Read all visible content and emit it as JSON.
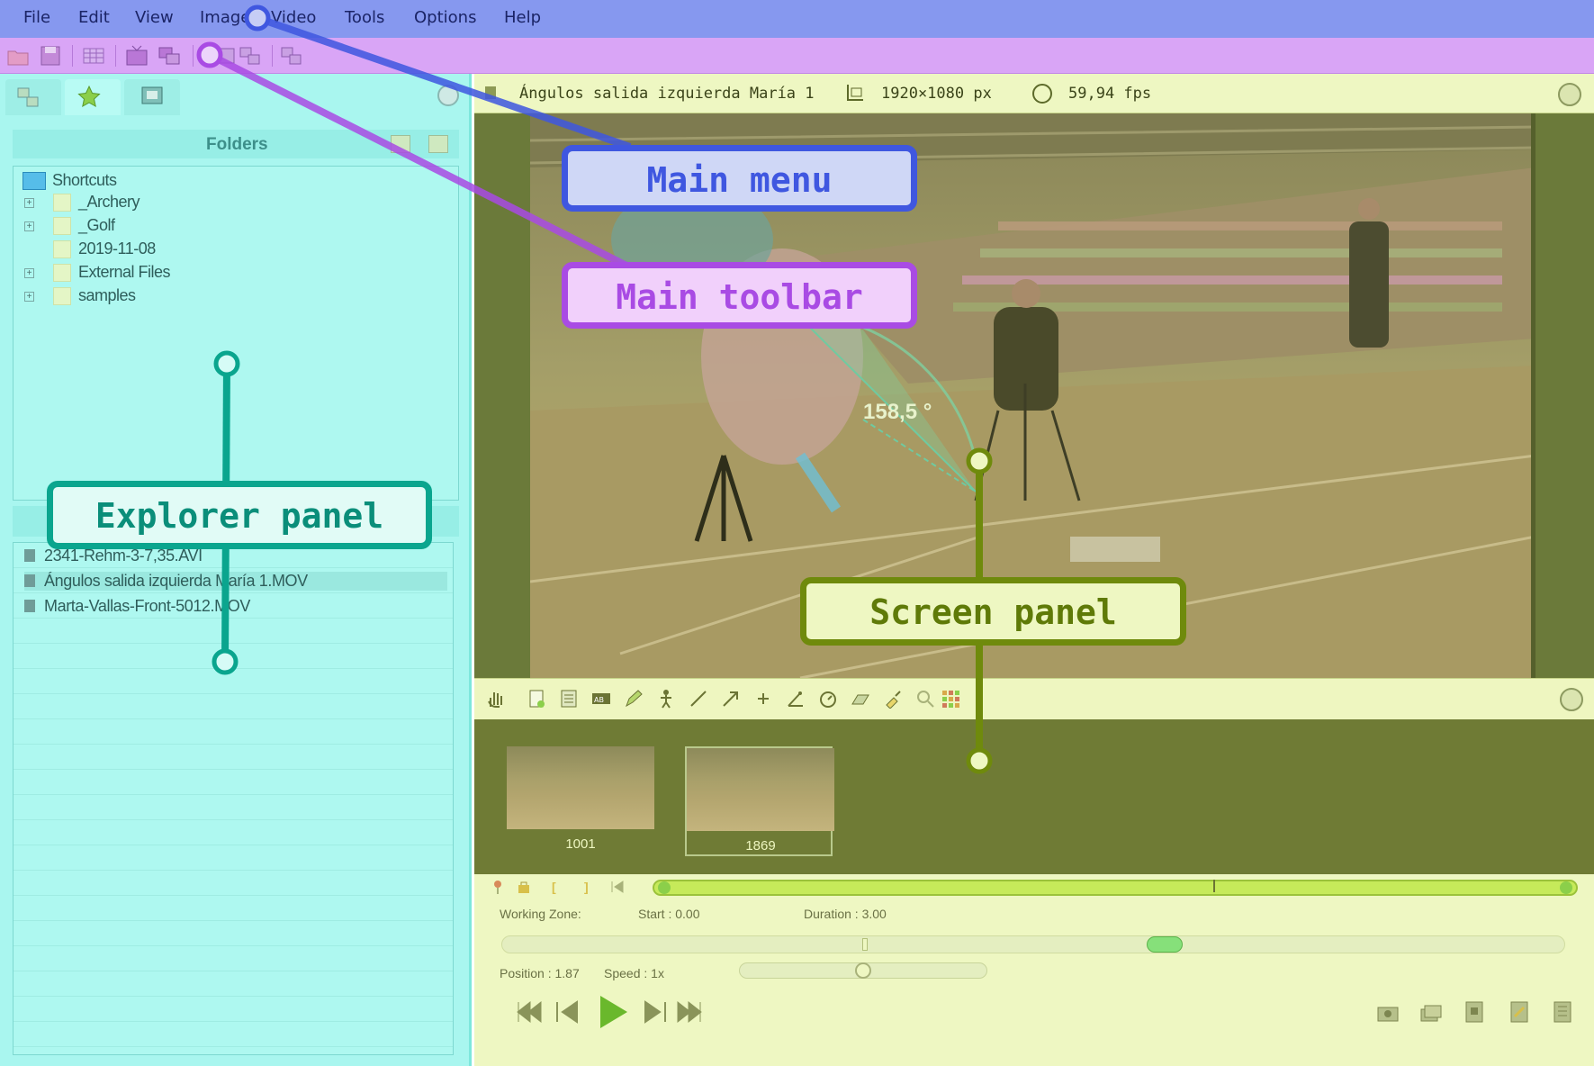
{
  "menu": {
    "items": [
      "File",
      "Edit",
      "View",
      "Image",
      "Video",
      "Tools",
      "Options",
      "Help"
    ]
  },
  "toolbar": {
    "icons": [
      "open-folder-icon",
      "save-icon",
      "grid-icon",
      "tv-icon",
      "multi-screen-icon",
      "capture-icon",
      "compare-icon",
      "export-icon"
    ]
  },
  "explorer": {
    "folders_title": "Folders",
    "tree": [
      {
        "label": "Shortcuts",
        "expandable": false
      },
      {
        "label": "_Archery",
        "expandable": true
      },
      {
        "label": "_Golf",
        "expandable": true
      },
      {
        "label": "2019-11-08",
        "expandable": false
      },
      {
        "label": "External Files",
        "expandable": true
      },
      {
        "label": "samples",
        "expandable": true
      }
    ],
    "files": [
      "2341-Rehm-3-7,35.AVI",
      "Ángulos salida izquierda María 1.MOV",
      "Marta-Vallas-Front-5012.MOV"
    ]
  },
  "screen": {
    "video_title": "Ángulos salida izquierda María 1",
    "resolution": "1920×1080 px",
    "fps": "59,94 fps",
    "angle_label": "158,5 °",
    "thumbnails": [
      "1001",
      "1869"
    ],
    "working_zone_label": "Working Zone:",
    "start": "Start : 0.00",
    "duration": "Duration : 3.00",
    "position": "Position : 1.87",
    "speed": "Speed : 1x"
  },
  "callouts": {
    "main_menu": "Main menu",
    "main_toolbar": "Main toolbar",
    "explorer_panel": "Explorer panel",
    "screen_panel": "Screen panel"
  },
  "colors": {
    "menu_bg": "#8698ef",
    "toolbar_bg": "#d9a5f6",
    "explorer_bg": "#a9f6ef",
    "screen_bg": "#6b7a3a",
    "menu_callout": "#3f57e0",
    "toolbar_callout": "#a94be4",
    "explorer_callout": "#0aa58e",
    "screen_callout": "#6f8a0c"
  }
}
